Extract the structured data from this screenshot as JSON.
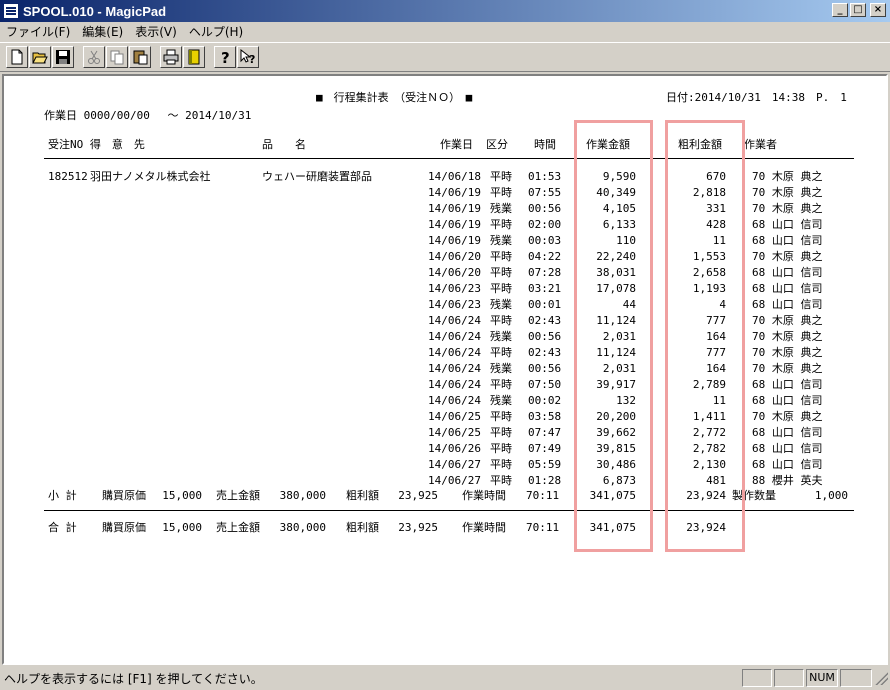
{
  "window": {
    "title": "SPOOL.010 - MagicPad"
  },
  "menu": [
    "ファイル(F)",
    "編集(E)",
    "表示(V)",
    "ヘルプ(H)"
  ],
  "toolbar": {
    "buttons": [
      "new-icon",
      "open-icon",
      "save-icon",
      "cut-icon",
      "copy-icon",
      "paste-icon",
      "print-icon",
      "book-icon",
      "help-icon",
      "context-help-icon"
    ]
  },
  "report": {
    "title": "■　行程集計表　（受注ＮＯ）　■",
    "date": "日付:2014/10/31　14:38　P.　1",
    "period": "作業日 0000/00/00　 ～ 2014/10/31",
    "headers": {
      "order_no": "受注NO 得　意　先",
      "product": "品　　名",
      "work_date": "作業日",
      "division": "区分",
      "time": "時間",
      "amount": "作業金額",
      "profit": "粗利金額",
      "worker": "作業者"
    },
    "order": {
      "no": "182512",
      "customer": "羽田ナノメタル株式会社",
      "product": "ウェハー研磨装置部品"
    },
    "rows": [
      [
        "14/06/18",
        "平時",
        "01:53",
        "9,590",
        "670",
        "70 木原 典之"
      ],
      [
        "14/06/19",
        "平時",
        "07:55",
        "40,349",
        "2,818",
        "70 木原 典之"
      ],
      [
        "14/06/19",
        "残業",
        "00:56",
        "4,105",
        "331",
        "70 木原 典之"
      ],
      [
        "14/06/19",
        "平時",
        "02:00",
        "6,133",
        "428",
        "68 山口 信司"
      ],
      [
        "14/06/19",
        "残業",
        "00:03",
        "110",
        "11",
        "68 山口 信司"
      ],
      [
        "14/06/20",
        "平時",
        "04:22",
        "22,240",
        "1,553",
        "70 木原 典之"
      ],
      [
        "14/06/20",
        "平時",
        "07:28",
        "38,031",
        "2,658",
        "68 山口 信司"
      ],
      [
        "14/06/23",
        "平時",
        "03:21",
        "17,078",
        "1,193",
        "68 山口 信司"
      ],
      [
        "14/06/23",
        "残業",
        "00:01",
        "44",
        "4",
        "68 山口 信司"
      ],
      [
        "14/06/24",
        "平時",
        "02:43",
        "11,124",
        "777",
        "70 木原 典之"
      ],
      [
        "14/06/24",
        "残業",
        "00:56",
        "2,031",
        "164",
        "70 木原 典之"
      ],
      [
        "14/06/24",
        "平時",
        "02:43",
        "11,124",
        "777",
        "70 木原 典之"
      ],
      [
        "14/06/24",
        "残業",
        "00:56",
        "2,031",
        "164",
        "70 木原 典之"
      ],
      [
        "14/06/24",
        "平時",
        "07:50",
        "39,917",
        "2,789",
        "68 山口 信司"
      ],
      [
        "14/06/24",
        "残業",
        "00:02",
        "132",
        "11",
        "68 山口 信司"
      ],
      [
        "14/06/25",
        "平時",
        "03:58",
        "20,200",
        "1,411",
        "70 木原 典之"
      ],
      [
        "14/06/25",
        "平時",
        "07:47",
        "39,662",
        "2,772",
        "68 山口 信司"
      ],
      [
        "14/06/26",
        "平時",
        "07:49",
        "39,815",
        "2,782",
        "68 山口 信司"
      ],
      [
        "14/06/27",
        "平時",
        "05:59",
        "30,486",
        "2,130",
        "68 山口 信司"
      ],
      [
        "14/06/27",
        "平時",
        "01:28",
        "6,873",
        "481",
        "88 櫻井 英夫"
      ]
    ],
    "subtotal": {
      "label": "小 計",
      "purchase_label": "購買原価",
      "purchase": "15,000",
      "sales_label": "売上金額",
      "sales": "380,000",
      "gross_label": "粗利額",
      "gross": "23,925",
      "worktime_label": "作業時間",
      "worktime": "70:11",
      "amount": "341,075",
      "profit": "23,924",
      "qty_label": "製作数量",
      "qty": "1,000"
    },
    "total": {
      "label": "合 計",
      "purchase_label": "購買原価",
      "purchase": "15,000",
      "sales_label": "売上金額",
      "sales": "380,000",
      "gross_label": "粗利額",
      "gross": "23,925",
      "worktime_label": "作業時間",
      "worktime": "70:11",
      "amount": "341,075",
      "profit": "23,924"
    }
  },
  "statusbar": {
    "message": "ヘルプを表示するには [F1] を押してください。",
    "num": "NUM"
  },
  "colors": {
    "highlight": "#f0a0a0",
    "titlebar": "#0a246a"
  }
}
